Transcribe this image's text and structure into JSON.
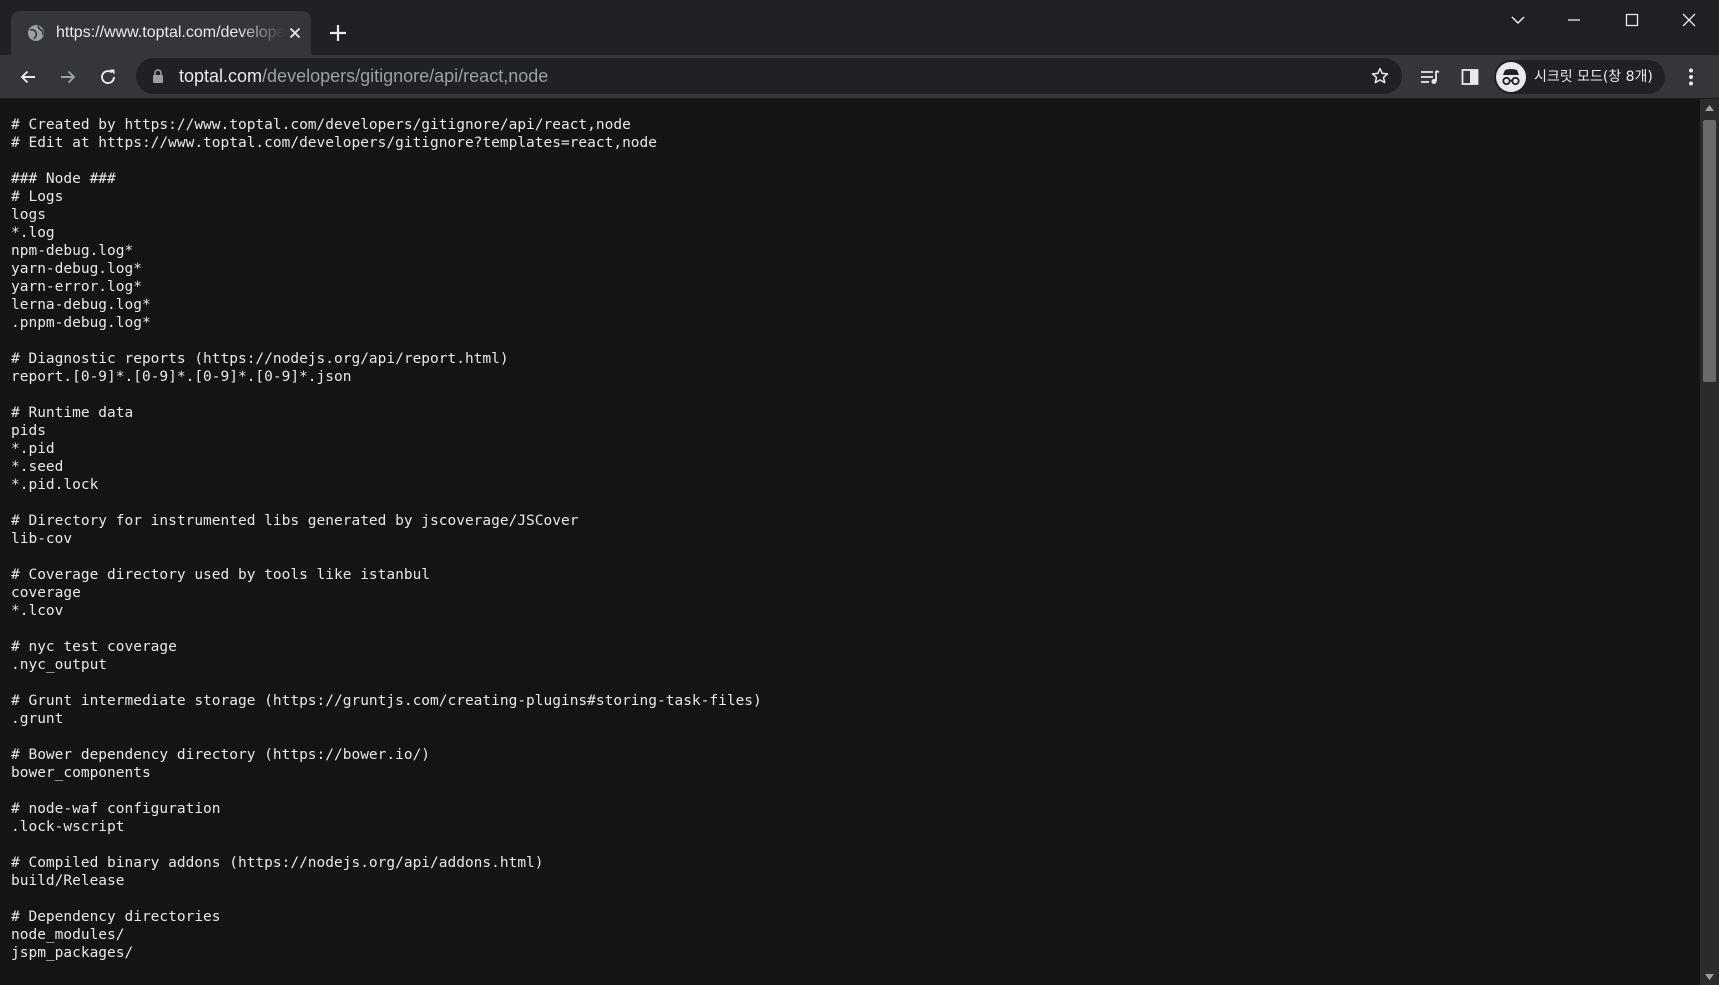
{
  "tab": {
    "title": "https://www.toptal.com/developers/gitignore/api/react,node",
    "favicon": "globe-icon"
  },
  "toolbar": {
    "url_host": "toptal.com",
    "url_path": "/developers/gitignore/api/react,node",
    "incognito_label": "시크릿 모드(창 8개)"
  },
  "icons": {
    "back": "back-arrow-icon",
    "forward": "forward-arrow-icon",
    "reload": "reload-icon",
    "lock": "lock-icon",
    "bookmark": "star-icon",
    "media": "media-queue-icon",
    "side_panel": "side-panel-icon",
    "menu": "kebab-menu-icon"
  },
  "colors": {
    "chrome_frame": "#202124",
    "toolbar": "#35363a",
    "page_background": "#141414",
    "text": "#e8e8e8"
  },
  "document_lines": [
    "# Created by https://www.toptal.com/developers/gitignore/api/react,node",
    "# Edit at https://www.toptal.com/developers/gitignore?templates=react,node",
    "",
    "### Node ###",
    "# Logs",
    "logs",
    "*.log",
    "npm-debug.log*",
    "yarn-debug.log*",
    "yarn-error.log*",
    "lerna-debug.log*",
    ".pnpm-debug.log*",
    "",
    "# Diagnostic reports (https://nodejs.org/api/report.html)",
    "report.[0-9]*.[0-9]*.[0-9]*.[0-9]*.json",
    "",
    "# Runtime data",
    "pids",
    "*.pid",
    "*.seed",
    "*.pid.lock",
    "",
    "# Directory for instrumented libs generated by jscoverage/JSCover",
    "lib-cov",
    "",
    "# Coverage directory used by tools like istanbul",
    "coverage",
    "*.lcov",
    "",
    "# nyc test coverage",
    ".nyc_output",
    "",
    "# Grunt intermediate storage (https://gruntjs.com/creating-plugins#storing-task-files)",
    ".grunt",
    "",
    "# Bower dependency directory (https://bower.io/)",
    "bower_components",
    "",
    "# node-waf configuration",
    ".lock-wscript",
    "",
    "# Compiled binary addons (https://nodejs.org/api/addons.html)",
    "build/Release",
    "",
    "# Dependency directories",
    "node_modules/",
    "jspm_packages/"
  ]
}
